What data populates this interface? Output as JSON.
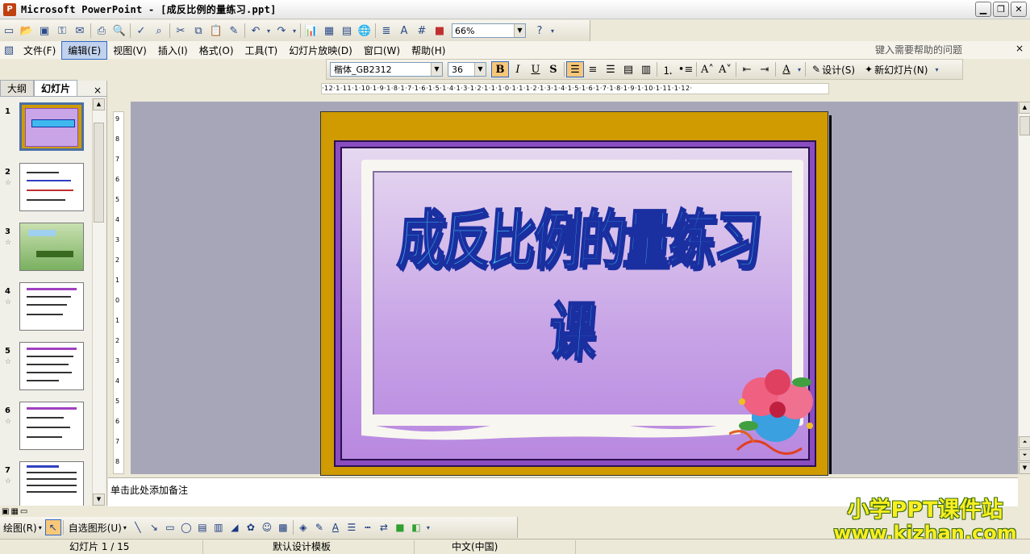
{
  "window": {
    "title": "Microsoft PowerPoint - [成反比例的量练习.ppt]",
    "app_icon": "P",
    "buttons": [
      "minimize",
      "restore",
      "close"
    ]
  },
  "standard_toolbar": {
    "zoom": "66%",
    "icons": [
      "new-icon",
      "open-icon",
      "save-icon",
      "permission-icon",
      "email-icon",
      "print-icon",
      "print-preview-icon",
      "spelling-icon",
      "research-icon",
      "cut-icon",
      "copy-icon",
      "paste-icon",
      "format-painter-icon",
      "undo-icon",
      "redo-icon",
      "chart-icon",
      "table-icon",
      "tables-borders-icon",
      "hyperlink-icon",
      "expand-icon",
      "grid-icon",
      "color-grayscale-icon",
      "help-icon"
    ]
  },
  "menubar": {
    "items": [
      {
        "label": "文件(F)",
        "active": false
      },
      {
        "label": "编辑(E)",
        "active": true
      },
      {
        "label": "视图(V)",
        "active": false
      },
      {
        "label": "插入(I)",
        "active": false
      },
      {
        "label": "格式(O)",
        "active": false
      },
      {
        "label": "工具(T)",
        "active": false
      },
      {
        "label": "幻灯片放映(D)",
        "active": false
      },
      {
        "label": "窗口(W)",
        "active": false
      },
      {
        "label": "帮助(H)",
        "active": false
      }
    ],
    "help_box": "键入需要帮助的问题",
    "close": "×"
  },
  "formatting_toolbar": {
    "font": "楷体_GB2312",
    "size": "36",
    "bold": "B",
    "italic": "I",
    "underline": "U",
    "shadow": "S",
    "design": "设计(S)",
    "new_slide": "新幻灯片(N)"
  },
  "outline_pane": {
    "tabs": [
      {
        "label": "大纲",
        "active": false
      },
      {
        "label": "幻灯片",
        "active": true
      }
    ],
    "close": "×",
    "thumbnails": [
      {
        "num": "1",
        "selected": true,
        "bg": "#8A4DC0"
      },
      {
        "num": "2",
        "selected": false,
        "bg": "#FFFFFF"
      },
      {
        "num": "3",
        "selected": false,
        "bg": "#7AB060"
      },
      {
        "num": "4",
        "selected": false,
        "bg": "#FFFFFF"
      },
      {
        "num": "5",
        "selected": false,
        "bg": "#FFFFFF"
      },
      {
        "num": "6",
        "selected": false,
        "bg": "#FFFFFF"
      },
      {
        "num": "7",
        "selected": false,
        "bg": "#FFFFFF"
      }
    ]
  },
  "ruler": {
    "horizontal": "·12·1·11·1·10·1·9·1·8·1·7·1·6·1·5·1·4·1·3·1·2·1·1·1·0·1·1·1·2·1·3·1·4·1·5·1·6·1·7·1·8·1·9·1·10·1·11·1·12·",
    "vertical": [
      "9",
      "8",
      "7",
      "6",
      "5",
      "4",
      "3",
      "2",
      "1",
      "0",
      "1",
      "2",
      "3",
      "4",
      "5",
      "6",
      "7",
      "8"
    ]
  },
  "slide": {
    "title": "成反比例的量练习课",
    "colors": {
      "outer": "#CF9B00",
      "frame": "#8A4DC0",
      "title_fill": "#3FB8F0",
      "title_stroke": "#1A2FA0"
    }
  },
  "notes": {
    "placeholder": "单击此处添加备注"
  },
  "drawing_toolbar": {
    "draw": "绘图(R)",
    "autoshapes": "自选图形(U)"
  },
  "statusbar": {
    "slide_info": "幻灯片 1 / 15",
    "template": "默认设计模板",
    "language": "中文(中国)"
  },
  "watermark": {
    "line1": "小学PPT课件站",
    "line2": "www.kjzhan.com"
  }
}
